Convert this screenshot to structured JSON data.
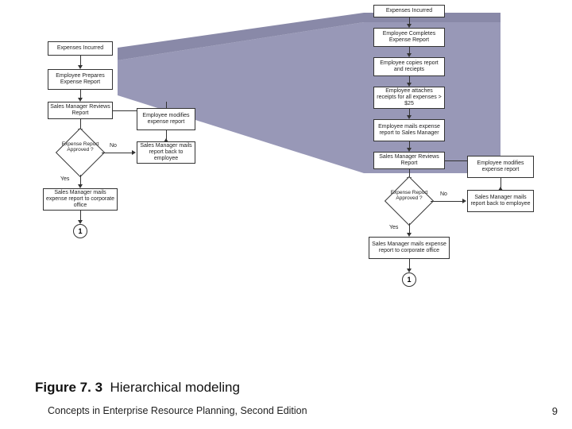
{
  "figure": {
    "number": "Figure 7. 3",
    "title": "Hierarchical modeling"
  },
  "footer": {
    "book": "Concepts in Enterprise Resource Planning, Second Edition",
    "page": "9"
  },
  "flowchart": {
    "left": {
      "start": "Expenses Incurred",
      "step1": "Employee Prepares Expense Report",
      "step2": "Sales Manager Reviews Report",
      "decision": "Expense Report Approved ?",
      "yes": "Yes",
      "no": "No",
      "modify": "Employee modifies expense report",
      "mailback": "Sales Manager mails report back to employee",
      "step3": "Sales Manager mails expense report to corporate office",
      "connector": "1"
    },
    "right": {
      "start": "Expenses Incurred",
      "step1": "Employee Completes Expense Report",
      "step2": "Employee copies report and reciepts",
      "step3": "Employee attaches receipts for all expenses > $25",
      "step4": "Employee mails expense report to Sales Manager",
      "step5": "Sales Manager Reviews Report",
      "decision": "Expense Report Approved ?",
      "yes": "Yes",
      "no": "No",
      "modify": "Employee modifies expense report",
      "mailback": "Sales Manager mails report back to employee",
      "step6": "Sales Manager mails expense report to corporate office",
      "connector": "1"
    }
  }
}
